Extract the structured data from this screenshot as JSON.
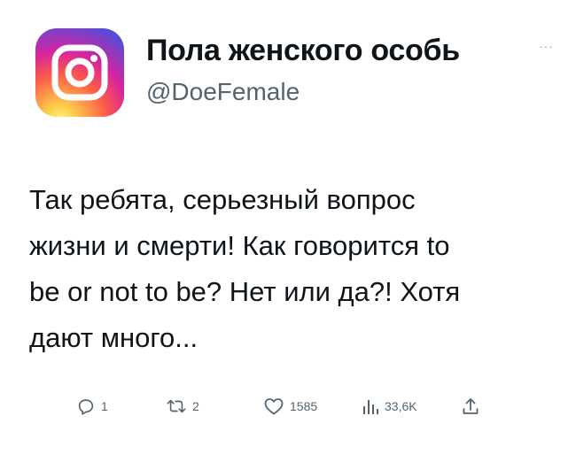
{
  "profile": {
    "display_name": "Пола женского особь",
    "handle": "@DoeFemale",
    "more_label": "···",
    "avatar_icon": "instagram-logo-icon"
  },
  "tweet": {
    "text": "Так ребята, серьезный вопрос\nжизни и смерти! Как говорится to\nbe or not to be? Нет или да?! Хотя\nдают много..."
  },
  "actions": {
    "replies": "1",
    "retweets": "2",
    "likes": "1585",
    "views": "33,6K"
  },
  "colors": {
    "text": "#0f1419",
    "secondary": "#536471"
  }
}
